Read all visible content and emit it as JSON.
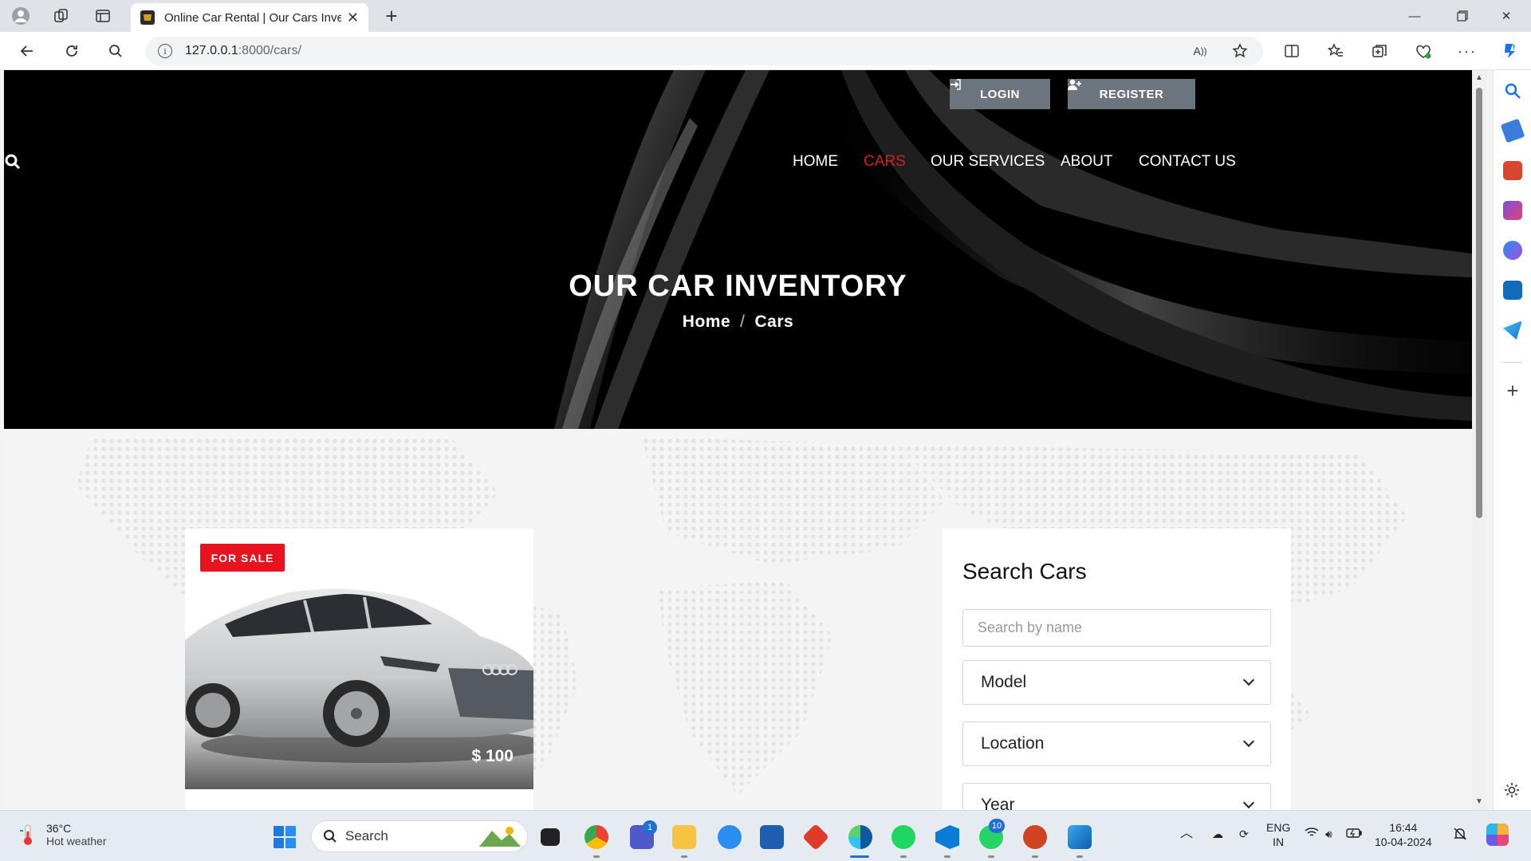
{
  "browser": {
    "tab_title": "Online Car Rental | Our Cars Inve",
    "url_host": "127.0.0.1",
    "url_rest": ":8000/cars/"
  },
  "header": {
    "login_label": "LOGIN",
    "register_label": "REGISTER",
    "nav": [
      "HOME",
      "CARS",
      "OUR SERVICES",
      "ABOUT",
      "CONTACT US"
    ],
    "active_nav": "CARS"
  },
  "hero": {
    "title": "OUR CAR INVENTORY",
    "breadcrumb_home": "Home",
    "breadcrumb_sep": "/",
    "breadcrumb_current": "Cars"
  },
  "car_card": {
    "badge": "FOR SALE",
    "price": "$ 100"
  },
  "search_panel": {
    "title": "Search Cars",
    "name_placeholder": "Search by name",
    "model_label": "Model",
    "location_label": "Location",
    "year_label": "Year"
  },
  "taskbar": {
    "weather_temp": "36°C",
    "weather_desc": "Hot weather",
    "search_label": "Search",
    "teams_badge": "1",
    "whatsapp_badge": "10",
    "lang_1": "ENG",
    "lang_2": "IN",
    "time": "16:44",
    "date": "10-04-2024"
  },
  "colors": {
    "accent_red": "#e8131f",
    "nav_active": "#d71d1d",
    "button_gray": "#6c757d"
  }
}
